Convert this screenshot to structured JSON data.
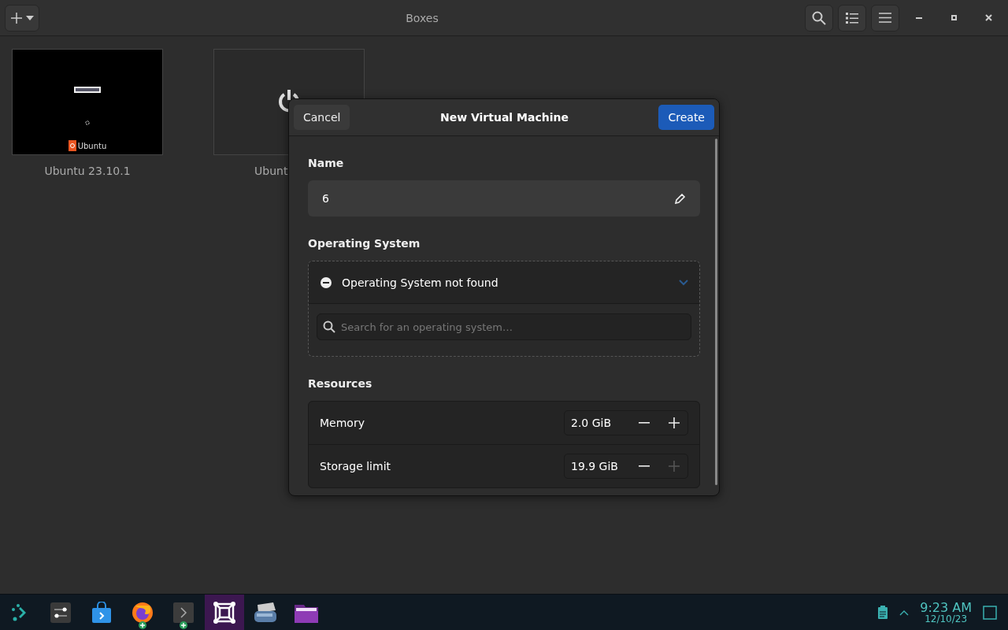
{
  "window": {
    "title": "Boxes"
  },
  "machines": [
    {
      "name": "Ubuntu 23.10.1",
      "running": true,
      "screen_label": "Ubuntu"
    },
    {
      "name": "Ubunt",
      "running": false
    }
  ],
  "dialog": {
    "title": "New Virtual Machine",
    "cancel": "Cancel",
    "create": "Create",
    "name_label": "Name",
    "name_value": "6",
    "os_label": "Operating System",
    "os_status": "Operating System not found",
    "os_search": {
      "placeholder": "Search for an operating system…"
    },
    "resources_label": "Resources",
    "resources": [
      {
        "label": "Memory",
        "value": "2.0 GiB",
        "plus_disabled": false
      },
      {
        "label": "Storage limit",
        "value": "19.9 GiB",
        "plus_disabled": true
      }
    ]
  },
  "taskbar": {
    "apps": [
      {
        "kind": "launcher",
        "selected": false,
        "badge": false
      },
      {
        "kind": "settings",
        "selected": false,
        "badge": false
      },
      {
        "kind": "store",
        "selected": false,
        "badge": false
      },
      {
        "kind": "browser",
        "selected": false,
        "badge": true
      },
      {
        "kind": "terminal",
        "selected": false,
        "badge": true
      },
      {
        "kind": "boxes",
        "selected": true,
        "badge": false
      },
      {
        "kind": "scanner",
        "selected": false,
        "badge": false
      },
      {
        "kind": "folder",
        "selected": false,
        "badge": false
      }
    ],
    "time": "9:23 AM",
    "date": "12/10/23"
  }
}
